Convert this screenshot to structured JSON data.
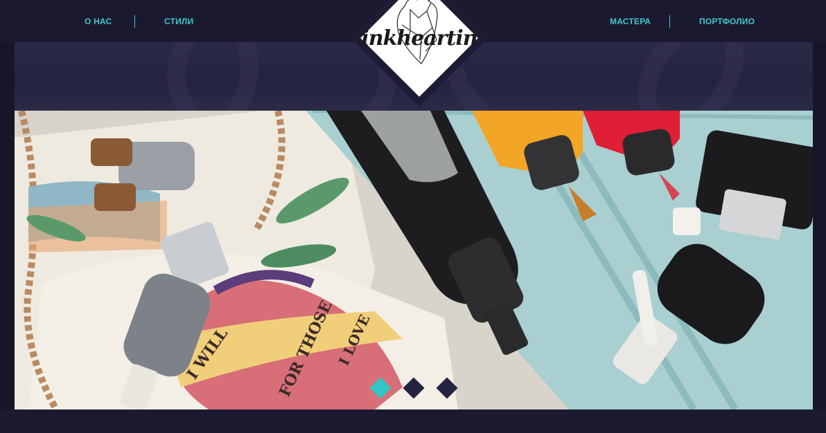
{
  "nav": {
    "left": [
      "О НАС",
      "СТИЛИ"
    ],
    "right": [
      "МАСТЕРА",
      "ПОРТФОЛИО"
    ]
  },
  "logo": {
    "text": "inkheartin"
  },
  "slider": {
    "active_index": 0,
    "count": 3
  },
  "colors": {
    "background": "#171629",
    "accent": "#3fc9c9",
    "dot_active": "#31c6c4",
    "dot_inactive": "#252340"
  },
  "hero": {
    "banner_texts": [
      "I WILL",
      "FOR THOSE",
      "I LOVE"
    ]
  }
}
